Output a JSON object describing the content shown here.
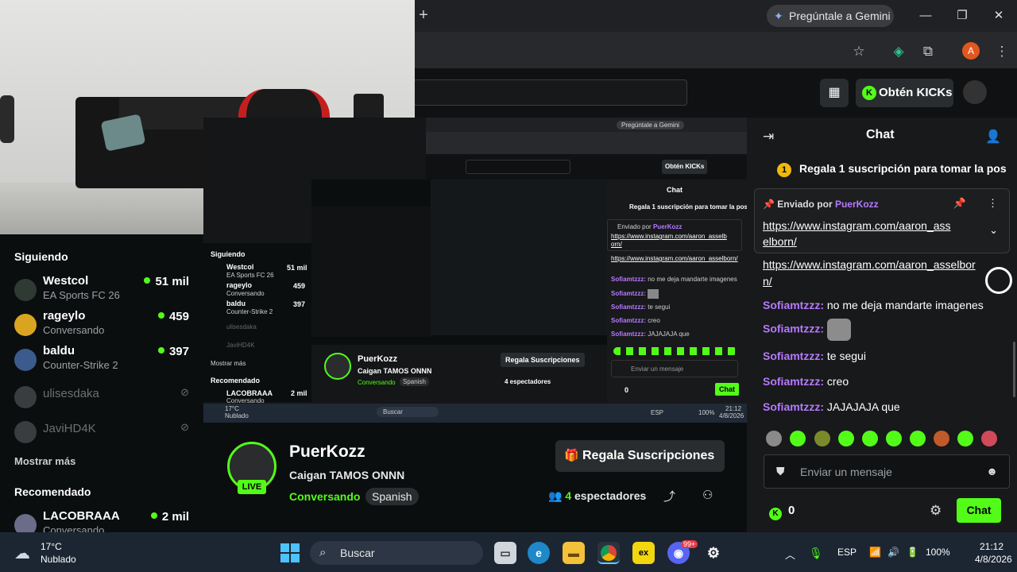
{
  "browser": {
    "gemini_label": "Pregúntale a Gemini",
    "new_tab": "+",
    "profile_initial": "A"
  },
  "kick_header": {
    "kicks_label": "Obtén KICKs"
  },
  "sidebar": {
    "following_title": "Siguiendo",
    "following": [
      {
        "name": "Westcol",
        "sub": "EA Sports FC 26",
        "count": "51 mil",
        "live": true
      },
      {
        "name": "rageylo",
        "sub": "Conversando",
        "count": "459",
        "live": true
      },
      {
        "name": "baldu",
        "sub": "Counter-Strike 2",
        "count": "397",
        "live": true
      },
      {
        "name": "ulisesdaka",
        "sub": "",
        "count": "",
        "live": false
      },
      {
        "name": "JaviHD4K",
        "sub": "",
        "count": "",
        "live": false
      }
    ],
    "show_more": "Mostrar más",
    "recommended_title": "Recomendado",
    "recommended": [
      {
        "name": "LACOBRAAA",
        "sub": "Conversando",
        "count": "2 mil"
      }
    ]
  },
  "nested": {
    "gemini": "Pregúntale a Gemini",
    "kicks": "Obtén KICKs",
    "chat_title": "Chat",
    "sub_banner": "Regala 1 suscripción para tomar la pos",
    "pinned_by": "Enviado por",
    "pinned_user": "PuerKozz",
    "pinned_link": "https://www.instagram.com/aaron_asselborn/",
    "link2": "https://www.instagram.com/aaron_asselborn/",
    "messages": [
      {
        "user": "Sofiamtzzz:",
        "text": "no me deja mandarte imagenes"
      },
      {
        "user": "Sofiamtzzz:",
        "text": ""
      },
      {
        "user": "Sofiamtzzz:",
        "text": "te segui"
      },
      {
        "user": "Sofiamtzzz:",
        "text": "creo"
      },
      {
        "user": "Sofiamtzzz:",
        "text": "JAJAJAJA que"
      }
    ],
    "input_placeholder": "Enviar un mensaje",
    "kicks_balance": "0",
    "chat_button": "Chat",
    "channel": "PuerKozz",
    "title": "Caigan TAMOS ONNN",
    "category": "Conversando",
    "language": "Spanish",
    "gift": "Regala Suscripciones",
    "viewers": "4 espectadores",
    "side_following": "Siguiendo",
    "side_items": [
      {
        "name": "Westcol",
        "sub": "EA Sports FC 26",
        "count": "51 mil"
      },
      {
        "name": "rageylo",
        "sub": "Conversando",
        "count": "459"
      },
      {
        "name": "baldu",
        "sub": "Counter-Strike 2",
        "count": "397"
      },
      {
        "name": "ulisesdaka",
        "sub": "",
        "count": ""
      },
      {
        "name": "JaviHD4K",
        "sub": "",
        "count": ""
      }
    ],
    "side_more": "Mostrar más",
    "side_recommended": "Recomendado",
    "side_rec_name": "LACOBRAAA",
    "side_rec_sub": "Conversando",
    "side_rec_count": "2 mil",
    "tb_temp": "17°C",
    "tb_weather": "Nublado",
    "tb_search": "Buscar",
    "tb_lang": "ESP",
    "tb_battery": "100%",
    "tb_time": "21:12",
    "tb_date": "4/8/2026"
  },
  "stream": {
    "channel": "PuerKozz",
    "title": "Caigan TAMOS ONNN",
    "category": "Conversando",
    "language": "Spanish",
    "live_badge": "LIVE",
    "gift_button": "Regala Suscripciones",
    "viewers_count": "4",
    "viewers_label": "espectadores"
  },
  "chat": {
    "title": "Chat",
    "sub_banner": "Regala 1 suscripción para tomar la pos",
    "sub_banner_coin": "1",
    "pinned": {
      "sent_by": "Enviado por",
      "user": "PuerKozz",
      "link_line1": "https://www.instagram.com/aaron_ass",
      "link_line2": "elborn/"
    },
    "link_msg_line1": "https://www.instagram.com/aaron_asselbor",
    "link_msg_line2": "n/",
    "messages": [
      {
        "user": "Sofiamtzzz:",
        "text": "no me deja mandarte imagenes"
      },
      {
        "user": "Sofiamtzzz:",
        "text": ""
      },
      {
        "user": "Sofiamtzzz:",
        "text": "te segui"
      },
      {
        "user": "Sofiamtzzz:",
        "text": "creo"
      },
      {
        "user": "Sofiamtzzz:",
        "text": "JAJAJAJA que"
      }
    ],
    "input_placeholder": "Enviar un mensaje",
    "kicks_balance": "0",
    "send_button": "Chat"
  },
  "taskbar": {
    "temperature": "17°C",
    "weather": "Nublado",
    "search": "Buscar",
    "language": "ESP",
    "battery": "100%",
    "time": "21:12",
    "date": "4/8/2026",
    "discord_badge": "99+"
  },
  "colors": {
    "kick_green": "#53fc18",
    "username_purple": "#b779ff",
    "background": "#0b0e0f"
  }
}
